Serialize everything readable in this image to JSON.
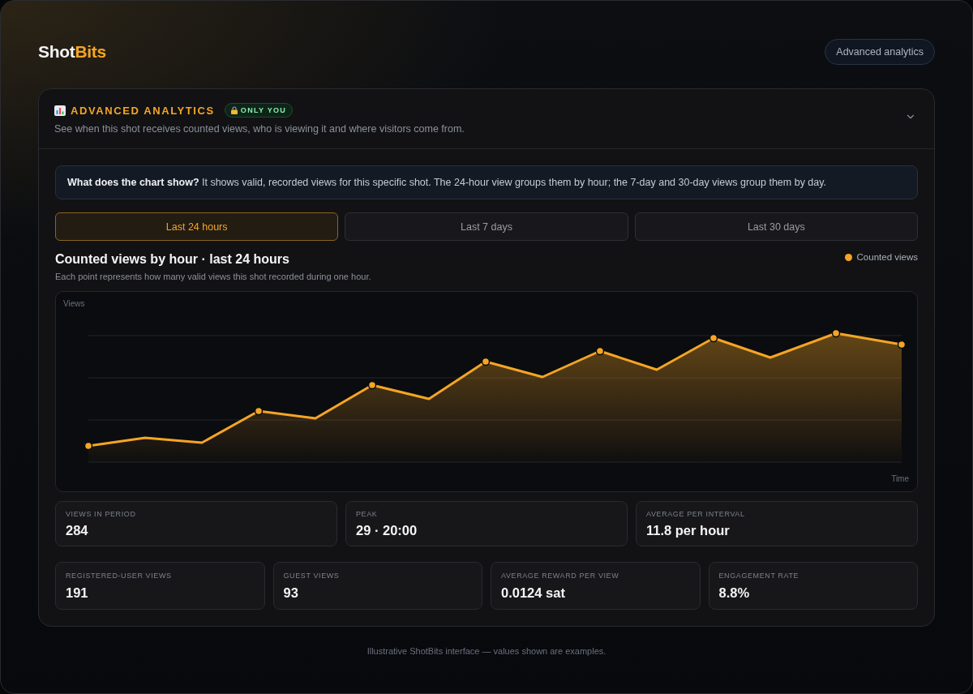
{
  "header": {
    "logo": {
      "text": "Shot",
      "accent": "Bits"
    },
    "button": "Advanced analytics"
  },
  "panel": {
    "title": "ADVANCED ANALYTICS",
    "badge": "ONLY YOU",
    "description": "See when this shot receives counted views, who is viewing it and where visitors come from.",
    "info": "**What does the chart show?** It shows valid, recorded views for this specific shot. The 24-hour view groups them by hour; the 7-day and 30-day views group them by day.",
    "tabs": [
      {
        "label": "Last 24 hours",
        "selected": true
      },
      {
        "label": "Last 7 days",
        "selected": false
      },
      {
        "label": "Last 30 days",
        "selected": false
      }
    ],
    "chart": {
      "title": "Counted views by hour · last 24 hours",
      "subtitle": "Each point represents how many valid views this shot recorded during one hour.",
      "legend": "Counted views",
      "y_axis_label": "Views",
      "x_axis_label": "Time"
    },
    "stats_primary": [
      {
        "label": "VIEWS IN PERIOD",
        "value": "284"
      },
      {
        "label": "PEAK",
        "value": "29 · 20:00"
      },
      {
        "label": "AVERAGE PER INTERVAL",
        "value": "11.8 per hour"
      }
    ],
    "stats_secondary": [
      {
        "label": "REGISTERED-USER VIEWS",
        "value": "191"
      },
      {
        "label": "GUEST VIEWS",
        "value": "93"
      },
      {
        "label": "AVERAGE REWARD PER VIEW",
        "value": "0.0124 sat"
      },
      {
        "label": "ENGAGEMENT RATE",
        "value": "8.8%"
      }
    ]
  },
  "footer": "Illustrative ShotBits interface — values shown are examples."
}
